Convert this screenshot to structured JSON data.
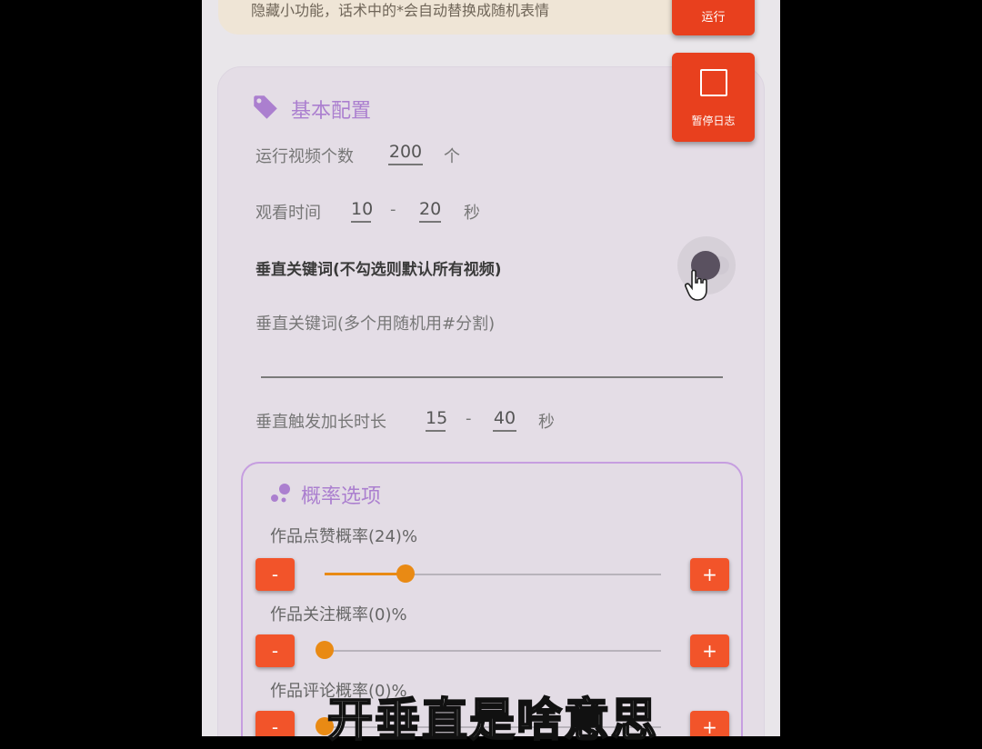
{
  "banner_text": "隐藏小功能，话术中的*会自动替换成随机表情",
  "fab_run_label": "运行",
  "fab_log_label": "暂停日志",
  "basic": {
    "title": "基本配置",
    "video_count_label": "运行视频个数",
    "video_count_value": "200",
    "video_count_unit": "个",
    "watch_time_label": "观看时间",
    "watch_min": "10",
    "watch_sep": "-",
    "watch_max": "20",
    "watch_unit": "秒",
    "vertical_toggle_label": "垂直关键词(不勾选则默认所有视频)",
    "vertical_toggle_on": false,
    "keywords_placeholder": "垂直关键词(多个用随机用#分割)",
    "keywords_value": "",
    "extend_label": "垂直触发加长时长",
    "extend_min": "15",
    "extend_sep": "-",
    "extend_max": "40",
    "extend_unit": "秒"
  },
  "probability": {
    "title": "概率选项",
    "sliders": [
      {
        "label": "作品点赞概率(24)%",
        "value": 24
      },
      {
        "label": "作品关注概率(0)%",
        "value": 0
      },
      {
        "label": "作品评论概率(0)%",
        "value": 0
      }
    ],
    "minus": "-",
    "plus": "+"
  },
  "subtitle": "开垂直是啥意思",
  "colors": {
    "accent": "#e8401e",
    "slider": "#e98a14",
    "section_title": "#ab7fcf"
  }
}
